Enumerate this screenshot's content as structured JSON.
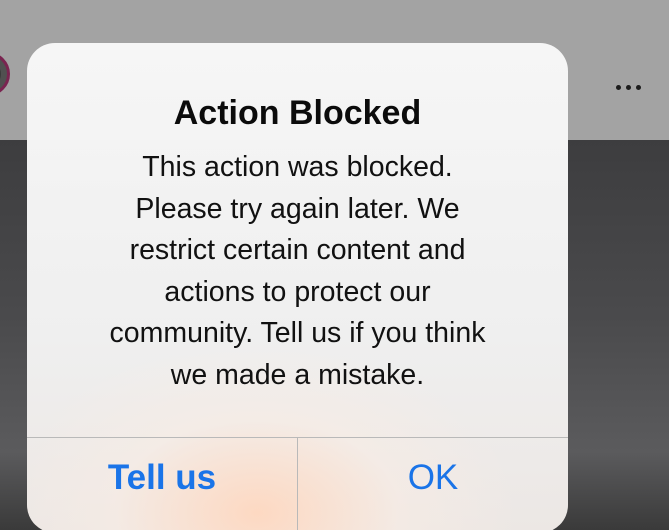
{
  "alert": {
    "title": "Action Blocked",
    "message_lines": [
      "This action was blocked.",
      "Please try again later. We",
      "restrict certain content and",
      "actions to protect our",
      "community. Tell us if you think",
      "we made a mistake."
    ],
    "buttons": {
      "tell_us_label": "Tell us",
      "ok_label": "OK"
    },
    "accent_color": "#1a74e8"
  },
  "background": {
    "more_icon": "more-horizontal-icon",
    "avatar_ring_color": "#7a2450"
  }
}
